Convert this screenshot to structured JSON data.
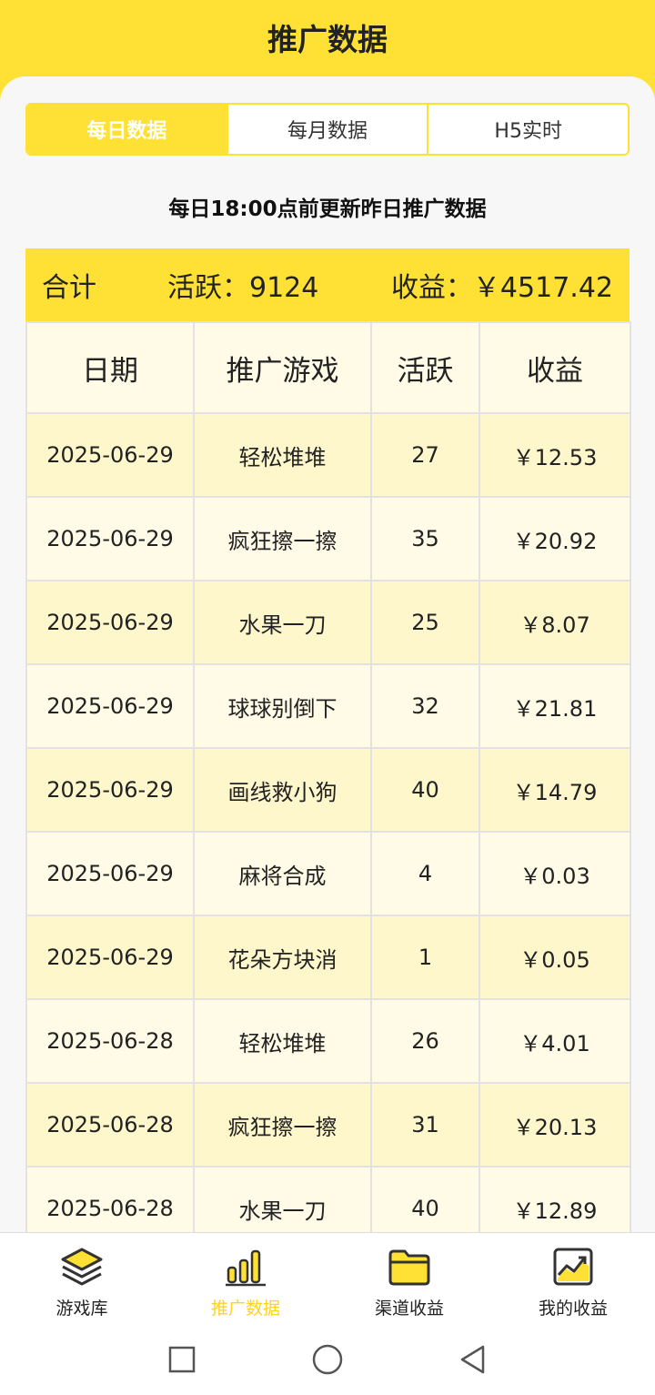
{
  "header": {
    "title": "推广数据"
  },
  "tabs": [
    {
      "label": "每日数据",
      "active": true
    },
    {
      "label": "每月数据",
      "active": false
    },
    {
      "label": "H5实时",
      "active": false
    }
  ],
  "notice": "每日18:00点前更新昨日推广数据",
  "summary": {
    "label": "合计",
    "active_text": "活跃：9124",
    "income_text": "收益：￥4517.42"
  },
  "table": {
    "headers": [
      "日期",
      "推广游戏",
      "活跃",
      "收益"
    ],
    "rows": [
      [
        "2025-06-29",
        "轻松堆堆",
        "27",
        "￥12.53"
      ],
      [
        "2025-06-29",
        "疯狂擦一擦",
        "35",
        "￥20.92"
      ],
      [
        "2025-06-29",
        "水果一刀",
        "25",
        "￥8.07"
      ],
      [
        "2025-06-29",
        "球球别倒下",
        "32",
        "￥21.81"
      ],
      [
        "2025-06-29",
        "画线救小狗",
        "40",
        "￥14.79"
      ],
      [
        "2025-06-29",
        "麻将合成",
        "4",
        "￥0.03"
      ],
      [
        "2025-06-29",
        "花朵方块消",
        "1",
        "￥0.05"
      ],
      [
        "2025-06-28",
        "轻松堆堆",
        "26",
        "￥4.01"
      ],
      [
        "2025-06-28",
        "疯狂擦一擦",
        "31",
        "￥20.13"
      ],
      [
        "2025-06-28",
        "水果一刀",
        "40",
        "￥12.89"
      ]
    ]
  },
  "bottom_nav": [
    {
      "label": "游戏库",
      "icon": "layers-icon",
      "active": false
    },
    {
      "label": "推广数据",
      "icon": "bar-chart-icon",
      "active": true
    },
    {
      "label": "渠道收益",
      "icon": "folder-icon",
      "active": false
    },
    {
      "label": "我的收益",
      "icon": "trend-chart-icon",
      "active": false
    }
  ],
  "colors": {
    "accent": "#ffe135",
    "row_odd": "#fff7cc",
    "row_even": "#fffbe6"
  }
}
